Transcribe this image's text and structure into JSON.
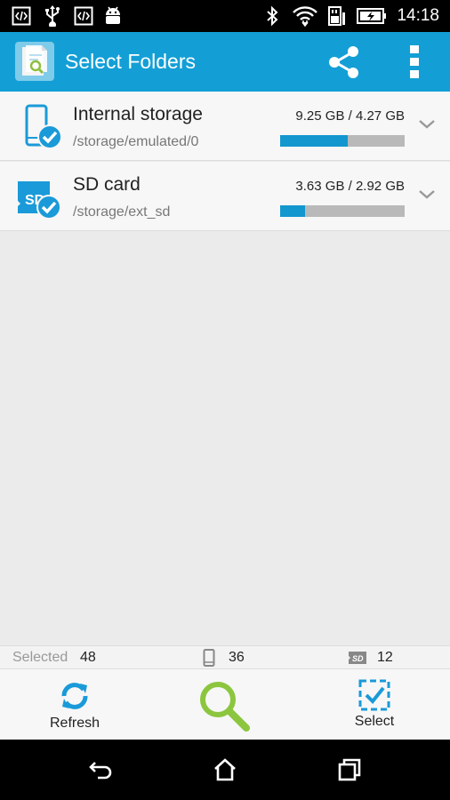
{
  "status_bar": {
    "time": "14:18",
    "icons": [
      "code-icon",
      "usb-icon",
      "code-icon",
      "android-icon",
      "bluetooth-icon",
      "wifi-icon",
      "sd-card-icon",
      "battery-charging-icon"
    ]
  },
  "app_bar": {
    "title": "Select Folders",
    "icons": [
      "app-logo-icon",
      "share-icon",
      "more-vert-icon"
    ]
  },
  "storages": [
    {
      "name": "Internal storage",
      "path": "/storage/emulated/0",
      "size": "9.25 GB / 4.27 GB",
      "usage_fraction": 0.54,
      "icon": "phone-check-icon"
    },
    {
      "name": "SD card",
      "path": "/storage/ext_sd",
      "size": "3.63 GB / 2.92 GB",
      "usage_fraction": 0.2,
      "icon": "sd-check-icon"
    }
  ],
  "summary": {
    "selected_label": "Selected",
    "selected_count": "48",
    "phone_count": "36",
    "sd_count": "12"
  },
  "toolbar": {
    "refresh_label": "Refresh",
    "select_label": "Select"
  },
  "colors": {
    "accent": "#139fd6",
    "progress": "#1496cf",
    "search_green": "#8cc63f",
    "check_blue": "#1a9ad8"
  }
}
